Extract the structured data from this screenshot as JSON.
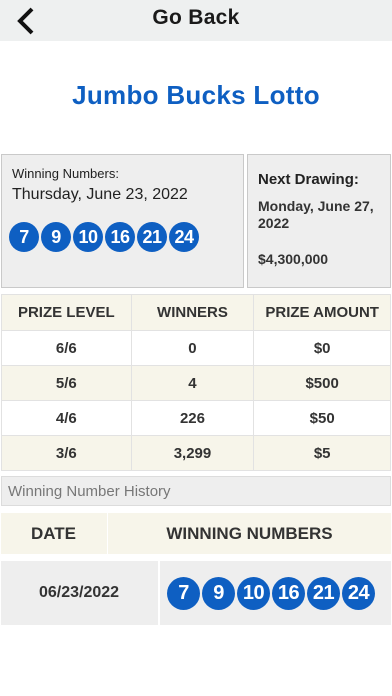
{
  "header": {
    "back_icon": "chevron-left-icon",
    "title": "Go Back"
  },
  "game": {
    "title": "Jumbo Bucks Lotto"
  },
  "winning": {
    "label": "Winning Numbers:",
    "date": "Thursday, June 23, 2022",
    "numbers": [
      "7",
      "9",
      "10",
      "16",
      "21",
      "24"
    ]
  },
  "next_drawing": {
    "label": "Next Drawing:",
    "date": "Monday, June 27, 2022",
    "jackpot": "$4,300,000"
  },
  "prize_table": {
    "headers": [
      "PRIZE LEVEL",
      "WINNERS",
      "PRIZE AMOUNT"
    ],
    "rows": [
      [
        "6/6",
        "0",
        "$0"
      ],
      [
        "5/6",
        "4",
        "$500"
      ],
      [
        "4/6",
        "226",
        "$50"
      ],
      [
        "3/6",
        "3,299",
        "$5"
      ]
    ]
  },
  "history": {
    "label": "Winning Number History",
    "headers": [
      "DATE",
      "WINNING NUMBERS"
    ],
    "rows": [
      {
        "date": "06/23/2022",
        "numbers": [
          "7",
          "9",
          "10",
          "16",
          "21",
          "24"
        ]
      }
    ]
  },
  "colors": {
    "accent": "#0e5fc2",
    "top_bar": "#eef0f0",
    "panel": "#eeeeee",
    "row_alt": "#f7f5ea"
  }
}
